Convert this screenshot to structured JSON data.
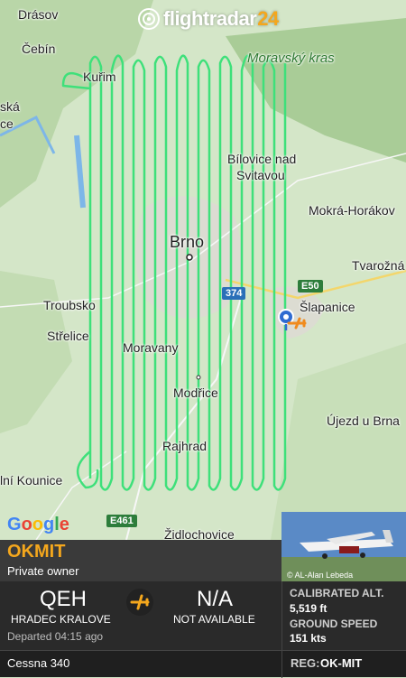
{
  "app": {
    "logo_word": "flightradar",
    "logo_num": "24",
    "map_attribution": "Google"
  },
  "map": {
    "places": {
      "drasov": "Drásov",
      "cebin": "Čebín",
      "ska": "ská",
      "ce": "ce",
      "kurim": "Kuřim",
      "moravsky_kras": "Moravský kras",
      "bilovice": "Bílovice nad",
      "svitavou": "Svitavou",
      "mokra": "Mokrá-Horákov",
      "brno": "Brno",
      "tvrdozna": "Tvarožná",
      "troubsko": "Troubsko",
      "slapanice": "Šlapanice",
      "strelice": "Střelice",
      "moravany": "Moravany",
      "modrice": "Modřice",
      "ujezd": "Újezd u Brna",
      "rajhrad": "Rajhrad",
      "kounice": "lní Kounice",
      "zidlochovice": "Židlochovice"
    },
    "shields": {
      "road_374": "374",
      "e50": "E50",
      "e461": "E461"
    },
    "track_color": "#3ee07a"
  },
  "flight": {
    "callsign": "OKMIT",
    "owner": "Private owner",
    "photo_credit": "© AL-Alan Lebeda",
    "origin_code": "QEH",
    "origin_name": "HRADEC KRALOVE",
    "destination_code": "N/A",
    "destination_name": "NOT AVAILABLE",
    "departed": "Departed 04:15 ago",
    "calibrated_alt_label": "CALIBRATED ALT.",
    "calibrated_alt_value": "5,519 ft",
    "ground_speed_label": "GROUND SPEED",
    "ground_speed_value": "151 kts",
    "aircraft_type": "Cessna 340",
    "reg_label": "REG:",
    "reg_value": "OK-MIT"
  },
  "colors": {
    "accent": "#f4a71d",
    "panel": "#2a2a2a"
  }
}
